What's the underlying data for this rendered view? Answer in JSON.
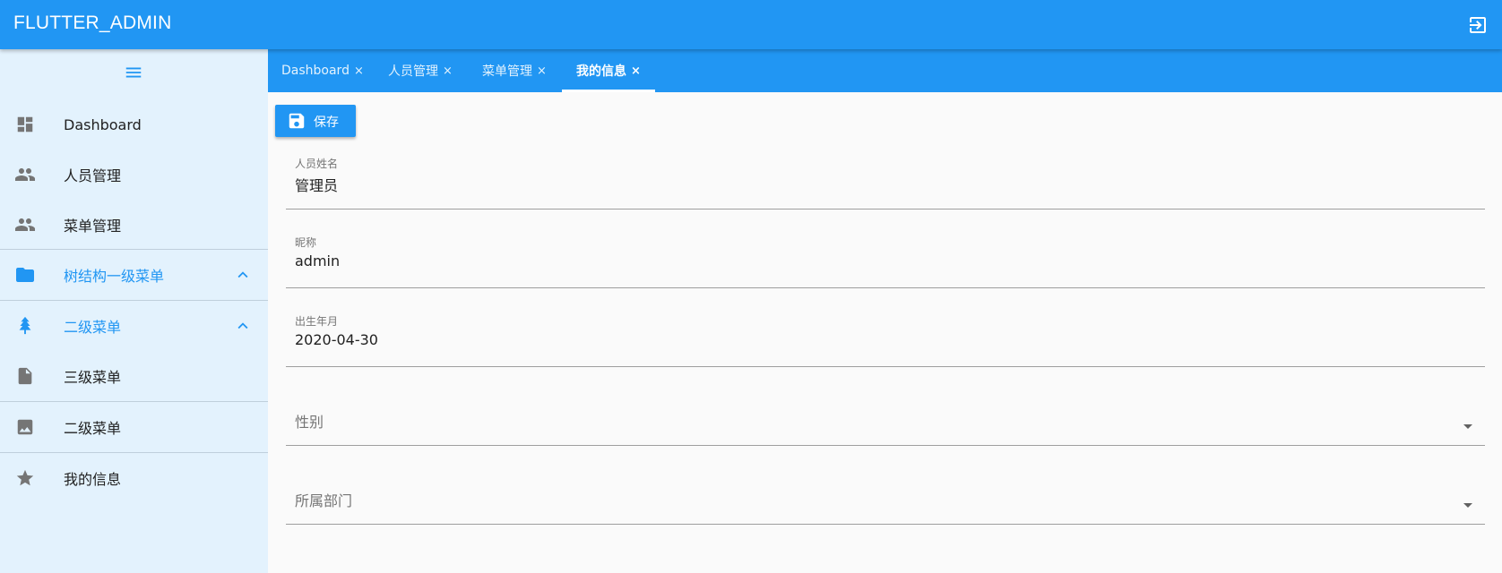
{
  "app": {
    "title": "FLUTTER_ADMIN"
  },
  "header": {
    "logout_icon": "logout-icon"
  },
  "sidebar": {
    "items": [
      {
        "label": "Dashboard",
        "icon": "dashboard-icon"
      },
      {
        "label": "人员管理",
        "icon": "people-icon"
      },
      {
        "label": "菜单管理",
        "icon": "people-icon"
      },
      {
        "label": "树结构一级菜单",
        "icon": "folder-icon",
        "expanded": true
      },
      {
        "label": "二级菜单",
        "icon": "tree-icon",
        "expanded": true
      },
      {
        "label": "三级菜单",
        "icon": "file-icon"
      },
      {
        "label": "二级菜单",
        "icon": "image-icon"
      },
      {
        "label": "我的信息",
        "icon": "star-icon"
      }
    ]
  },
  "tabs": [
    {
      "label": "Dashboard",
      "close": "×"
    },
    {
      "label": "人员管理",
      "close": "×"
    },
    {
      "label": "菜单管理",
      "close": "×"
    },
    {
      "label": "我的信息",
      "close": "×",
      "selected": true
    }
  ],
  "toolbar": {
    "save_label": "保存",
    "save_icon": "save-icon"
  },
  "form": {
    "name": {
      "label": "人员姓名",
      "value": "管理员"
    },
    "nickname": {
      "label": "昵称",
      "value": "admin"
    },
    "birth": {
      "label": "出生年月",
      "value": "2020-04-30"
    },
    "gender": {
      "placeholder": "性别"
    },
    "department": {
      "placeholder": "所属部门"
    }
  },
  "colors": {
    "primary": "#2196f3",
    "sidebar_bg": "#e3f2fd",
    "icon_grey": "#757575"
  }
}
